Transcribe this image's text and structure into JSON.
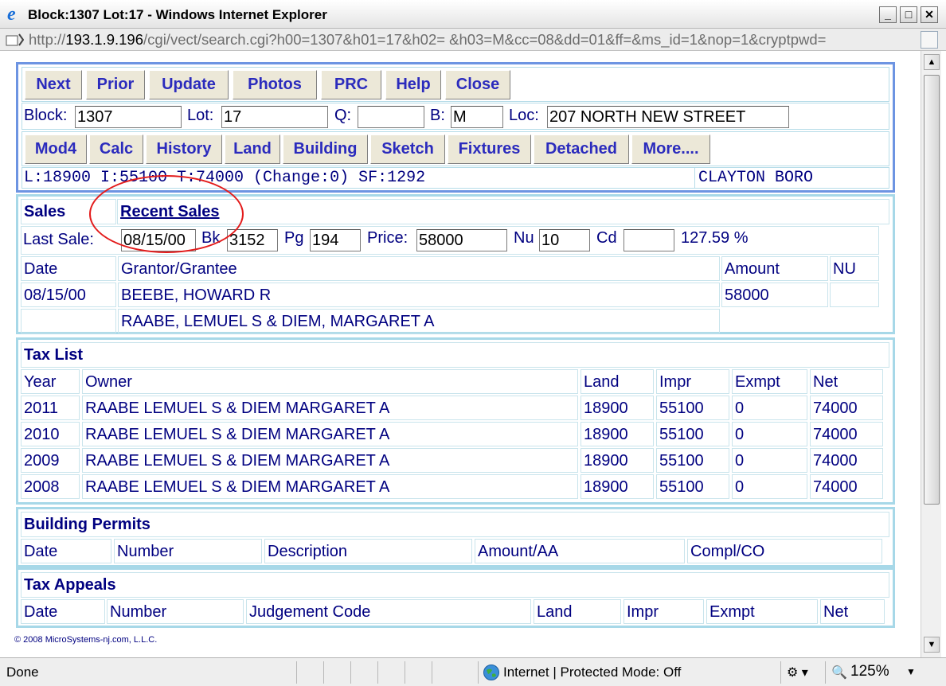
{
  "window": {
    "title": "Block:1307 Lot:17 - Windows Internet Explorer",
    "minimize": "_",
    "maximize": "□",
    "close": "✕"
  },
  "address": {
    "prefix": "http://",
    "host": "193.1.9.196",
    "path": "/cgi/vect/search.cgi?h00=1307&h01=17&h02= &h03=M&cc=08&dd=01&ff=&ms_id=1&nop=1&cryptpwd="
  },
  "nav_buttons": [
    "Next",
    "Prior",
    "Update",
    "Photos",
    "PRC",
    "Help",
    "Close"
  ],
  "search": {
    "block_label": "Block:",
    "block_value": "1307",
    "lot_label": "Lot:",
    "lot_value": "17",
    "q_label": "Q:",
    "q_value": "",
    "b_label": "B:",
    "b_value": "M",
    "loc_label": "Loc:",
    "loc_value": "207 NORTH NEW STREET"
  },
  "tab_buttons": [
    "Mod4",
    "Calc",
    "History",
    "Land",
    "Building",
    "Sketch",
    "Fixtures",
    "Detached",
    "More...."
  ],
  "summary": {
    "values": "L:18900 I:55100 T:74000 (Change:0) SF:1292",
    "municipality": "CLAYTON BORO"
  },
  "sales": {
    "title": "Sales",
    "recent_link": "Recent Sales",
    "last_sale_label": "Last Sale:",
    "date_value": "08/15/00",
    "bk_label": "Bk",
    "bk_value": "3152",
    "pg_label": "Pg",
    "pg_value": "194",
    "price_label": "Price:",
    "price_value": "58000",
    "nu_label": "Nu",
    "nu_value": "10",
    "cd_label": "Cd",
    "cd_value": "",
    "ratio": "127.59 %",
    "headers": [
      "Date",
      "Grantor/Grantee",
      "Amount",
      "NU"
    ],
    "rows": [
      {
        "date": "08/15/00",
        "name": "BEEBE, HOWARD R",
        "amount": "58000",
        "nu": ""
      },
      {
        "date": "",
        "name": "RAABE, LEMUEL S & DIEM, MARGARET A"
      }
    ]
  },
  "tax_list": {
    "title": "Tax List",
    "headers": [
      "Year",
      "Owner",
      "Land",
      "Impr",
      "Exmpt",
      "Net"
    ],
    "rows": [
      [
        "2011",
        "RAABE LEMUEL S & DIEM MARGARET A",
        "18900",
        "55100",
        "0",
        "74000"
      ],
      [
        "2010",
        "RAABE LEMUEL S & DIEM MARGARET A",
        "18900",
        "55100",
        "0",
        "74000"
      ],
      [
        "2009",
        "RAABE LEMUEL S & DIEM MARGARET A",
        "18900",
        "55100",
        "0",
        "74000"
      ],
      [
        "2008",
        "RAABE LEMUEL S & DIEM MARGARET A",
        "18900",
        "55100",
        "0",
        "74000"
      ]
    ]
  },
  "permits": {
    "title": "Building Permits",
    "headers": [
      "Date",
      "Number",
      "Description",
      "Amount/AA",
      "Compl/CO"
    ]
  },
  "appeals": {
    "title": "Tax Appeals",
    "headers": [
      "Date",
      "Number",
      "Judgement Code",
      "Land",
      "Impr",
      "Exmpt",
      "Net"
    ]
  },
  "copyright": "© 2008 MicroSystems-nj.com, L.L.C.",
  "status": {
    "left": "Done",
    "zone": "Internet | Protected Mode: Off",
    "zoom": "125%"
  },
  "colors": {
    "accent_border": "#6d94e2",
    "panel_border": "#a7d8e8",
    "button_text": "#2b2bbd",
    "text": "#000080",
    "annotation_ring": "#e31b1b"
  }
}
